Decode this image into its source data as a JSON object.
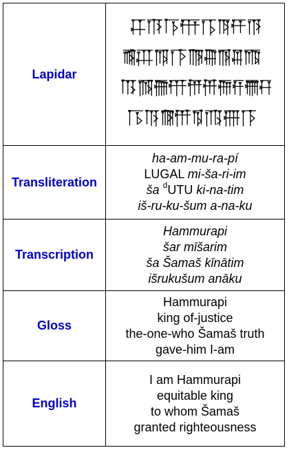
{
  "rows": [
    {
      "label": "Lapidar",
      "cuneiform_lines": 4
    },
    {
      "label": "Transliteration",
      "lines": [
        [
          {
            "t": "ha-am-mu-ra-pí",
            "i": true
          }
        ],
        [
          {
            "t": "LUGAL ",
            "i": false
          },
          {
            "t": "mi-ša-ri-im",
            "i": true
          }
        ],
        [
          {
            "t": "ša ",
            "i": true
          },
          {
            "t": "d",
            "i": false,
            "sup": true
          },
          {
            "t": "UTU ",
            "i": false
          },
          {
            "t": "ki-na-tim",
            "i": true
          }
        ],
        [
          {
            "t": "iš-ru-ku-šum a-na-ku",
            "i": true
          }
        ]
      ]
    },
    {
      "label": "Transcription",
      "lines": [
        [
          {
            "t": "Hammurapi",
            "i": true
          }
        ],
        [
          {
            "t": "šar mīšarim",
            "i": true
          }
        ],
        [
          {
            "t": "ša Šamaš kīnātim",
            "i": true
          }
        ],
        [
          {
            "t": "išrukušum anāku",
            "i": true
          }
        ]
      ]
    },
    {
      "label": "Gloss",
      "lines": [
        [
          {
            "t": "Hammurapi",
            "i": false
          }
        ],
        [
          {
            "t": "king of-justice",
            "i": false
          }
        ],
        [
          {
            "t": "the-one-who Šamaš truth",
            "i": false
          }
        ],
        [
          {
            "t": "gave-him I-am",
            "i": false
          }
        ]
      ]
    },
    {
      "label": "English",
      "lines": [
        [
          {
            "t": "I am Hammurapi",
            "i": false
          }
        ],
        [
          {
            "t": "equitable king",
            "i": false
          }
        ],
        [
          {
            "t": "to whom Šamaš",
            "i": false
          }
        ],
        [
          {
            "t": "granted righteousness",
            "i": false
          }
        ]
      ]
    }
  ],
  "colors": {
    "label": "#0000cc",
    "text": "#000000",
    "border": "#000000"
  }
}
